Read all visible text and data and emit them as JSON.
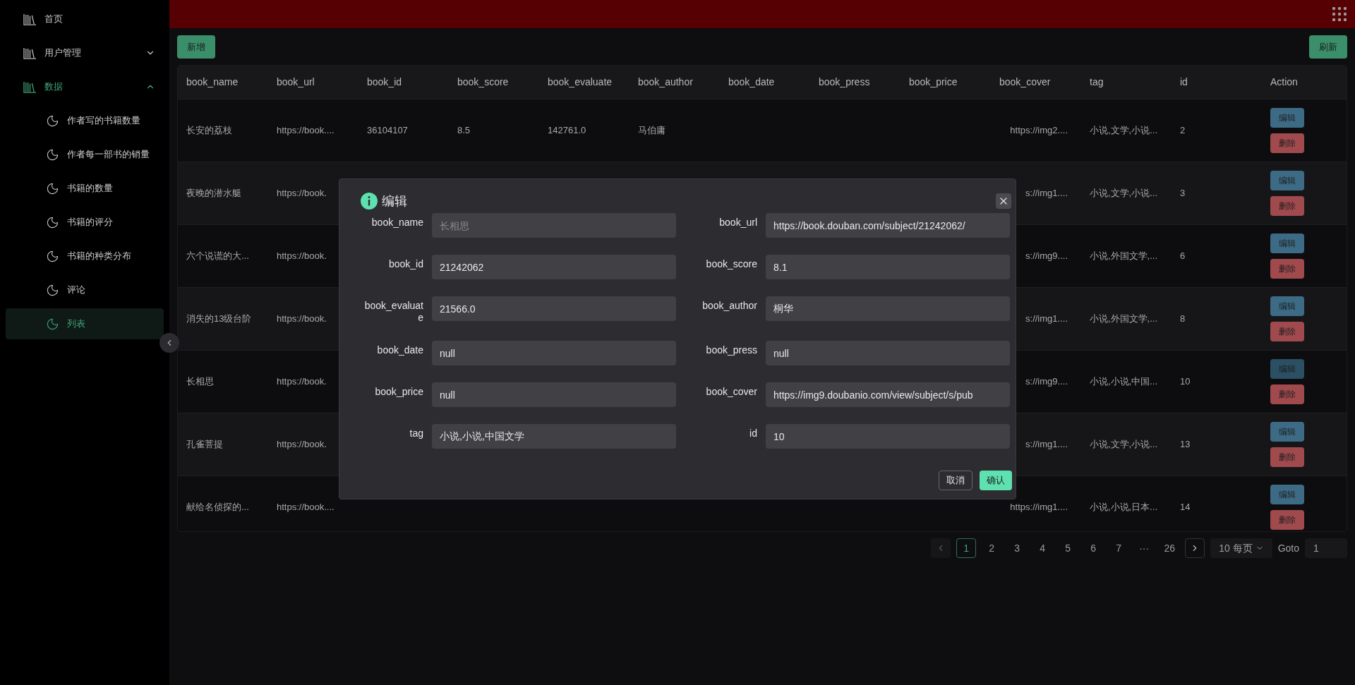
{
  "sidebar": {
    "items": [
      {
        "label": "首页",
        "selected": false
      },
      {
        "label": "用户管理",
        "selected": false,
        "expanded": false
      },
      {
        "label": "数据",
        "selected": true,
        "expanded": true,
        "children": [
          {
            "label": "作者写的书籍数量",
            "selected": false
          },
          {
            "label": "作者每一部书的销量",
            "selected": false
          },
          {
            "label": "书籍的数量",
            "selected": false
          },
          {
            "label": "书籍的评分",
            "selected": false
          },
          {
            "label": "书籍的种类分布",
            "selected": false
          },
          {
            "label": "评论",
            "selected": false
          },
          {
            "label": "列表",
            "selected": true
          }
        ]
      }
    ]
  },
  "toolbar": {
    "add_button": "新增",
    "refresh_button": "刷新"
  },
  "table": {
    "columns": [
      "book_name",
      "book_url",
      "book_id",
      "book_score",
      "book_evaluate",
      "book_author",
      "book_date",
      "book_press",
      "book_price",
      "book_cover",
      "tag",
      "id",
      "Action"
    ],
    "rows": [
      {
        "cells": [
          "长安的荔枝",
          "https://book....",
          "36104107",
          "8.5",
          "142761.0",
          "马伯庸",
          null,
          null,
          null,
          "https://img2....",
          "小说,文学,小说...",
          "2"
        ],
        "actions": [
          {
            "kind": "edit",
            "label": "编辑",
            "focused": false
          },
          {
            "kind": "delete",
            "label": "删除"
          }
        ]
      },
      {
        "cells": [
          "夜晚的潜水艇",
          "https://book.",
          null,
          null,
          null,
          null,
          null,
          null,
          null,
          "s://img1....",
          "小说,文学,小说...",
          "3"
        ],
        "actions": [
          {
            "kind": "edit",
            "label": "编辑",
            "focused": false
          },
          {
            "kind": "delete",
            "label": "删除"
          }
        ]
      },
      {
        "cells": [
          "六个说谎的大...",
          "https://book.",
          null,
          null,
          null,
          null,
          null,
          null,
          null,
          "s://img9....",
          "小说,外国文学,...",
          "6"
        ],
        "actions": [
          {
            "kind": "edit",
            "label": "编辑",
            "focused": false
          },
          {
            "kind": "delete",
            "label": "删除"
          }
        ]
      },
      {
        "cells": [
          "消失的13级台阶",
          "https://book.",
          null,
          null,
          null,
          null,
          null,
          null,
          null,
          "s://img1....",
          "小说,外国文学,...",
          "8"
        ],
        "actions": [
          {
            "kind": "edit",
            "label": "编辑",
            "focused": false
          },
          {
            "kind": "delete",
            "label": "删除"
          }
        ]
      },
      {
        "cells": [
          "长相思",
          "https://book.",
          null,
          null,
          null,
          null,
          null,
          null,
          null,
          "s://img9....",
          "小说,小说,中国...",
          "10"
        ],
        "actions": [
          {
            "kind": "edit",
            "label": "编辑",
            "focused": true
          },
          {
            "kind": "delete",
            "label": "删除"
          }
        ]
      },
      {
        "cells": [
          "孔雀菩提",
          "https://book.",
          null,
          null,
          null,
          null,
          null,
          null,
          null,
          "s://img1....",
          "小说,文学,小说...",
          "13"
        ],
        "actions": [
          {
            "kind": "edit",
            "label": "编辑",
            "focused": false
          },
          {
            "kind": "delete",
            "label": "删除"
          }
        ]
      },
      {
        "cells": [
          "献给名侦探的...",
          "https://book....",
          null,
          null,
          null,
          null,
          null,
          null,
          null,
          "https://img1....",
          "小说,小说,日本...",
          "14"
        ],
        "actions": [
          {
            "kind": "edit",
            "label": "编辑",
            "focused": false
          },
          {
            "kind": "delete",
            "label": "删除"
          }
        ]
      }
    ]
  },
  "pagination": {
    "prev_disabled": true,
    "pages": [
      {
        "label": "1",
        "selected": true
      },
      {
        "label": "2",
        "selected": false
      },
      {
        "label": "3",
        "selected": false
      },
      {
        "label": "4",
        "selected": false
      },
      {
        "label": "5",
        "selected": false
      },
      {
        "label": "6",
        "selected": false
      },
      {
        "label": "7",
        "selected": false
      },
      {
        "label": "···",
        "selected": false
      },
      {
        "label": "26",
        "selected": false
      }
    ],
    "page_size": "10 每页",
    "goto_label": "Goto",
    "goto_value": "1"
  },
  "dialog": {
    "title": "编辑",
    "fields": [
      {
        "label": "book_name",
        "placeholder": "长相思"
      },
      {
        "label": "book_url",
        "value": "https://book.douban.com/subject/21242062/"
      },
      {
        "label": "book_id",
        "value": "21242062"
      },
      {
        "label": "book_score",
        "value": "8.1"
      },
      {
        "label": "book_evaluate",
        "value": "21566.0"
      },
      {
        "label": "book_author",
        "value": "桐华"
      },
      {
        "label": "book_date",
        "value": "null"
      },
      {
        "label": "book_press",
        "value": "null"
      },
      {
        "label": "book_price",
        "value": "null"
      },
      {
        "label": "book_cover",
        "value": "https://img9.doubanio.com/view/subject/s/pub"
      },
      {
        "label": "tag",
        "value": "小说,小说,中国文学"
      },
      {
        "label": "id",
        "value": "10"
      }
    ],
    "cancel_button": "取消",
    "confirm_button": "确认"
  }
}
